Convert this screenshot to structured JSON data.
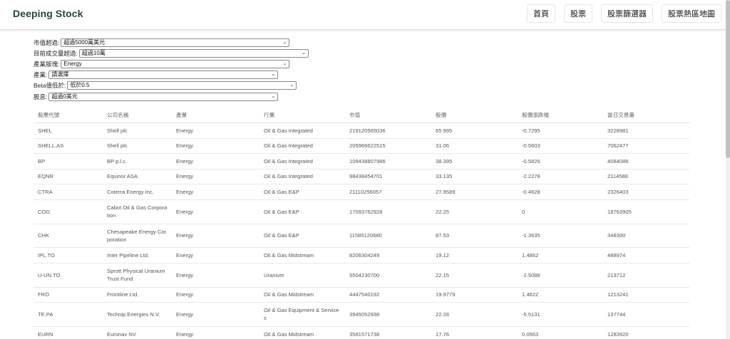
{
  "nav": {
    "brand": "Deeping Stock",
    "items": [
      "首頁",
      "股票",
      "股票篩選器",
      "股票熱區地圖"
    ]
  },
  "filters": [
    {
      "label": "市值超過:",
      "value": "超過5000萬美元"
    },
    {
      "label": "目前成交量超過:",
      "value": "超過10萬"
    },
    {
      "label": "產業版塊:",
      "value": "Energy"
    },
    {
      "label": "產業:",
      "value": "請選擇"
    },
    {
      "label": "Beta值低於:",
      "value": "低於0.5"
    },
    {
      "label": "股息:",
      "value": "超過0美元"
    }
  ],
  "table": {
    "headers": [
      "股票代號",
      "公司名稱",
      "產業",
      "行業",
      "市值",
      "股價",
      "股價漲跌幅",
      "當日交易量"
    ],
    "rows": [
      [
        "SHEL",
        "Shell plc",
        "Energy",
        "Oil & Gas Integrated",
        "219120565036",
        "65.995",
        "-0.7295",
        "3228981"
      ],
      [
        "SHELL.AS",
        "Shell plc",
        "Energy",
        "Oil & Gas Integrated",
        "205966622515",
        "31.06",
        "-0.5603",
        "7062477"
      ],
      [
        "BP",
        "BP p.l.c.",
        "Energy",
        "Oil & Gas Integrated",
        "109438807986",
        "38.395",
        "-0.5826",
        "4084086"
      ],
      [
        "EQNR",
        "Equinor ASA",
        "Energy",
        "Oil & Gas Integrated",
        "98438454701",
        "33.135",
        "-2.2278",
        "2114588"
      ],
      [
        "CTRA",
        "Coterra Energy Inc.",
        "Energy",
        "Oil & Gas E&P",
        "21110256057",
        "27.9589",
        "-0.4628",
        "2326403"
      ],
      [
        "COG",
        "Cabot Oil & Gas Corporation",
        "Energy",
        "Oil & Gas E&P",
        "17093762928",
        "22.25",
        "0",
        "18763905"
      ],
      [
        "CHK",
        "Chesapeake Energy Corporation",
        "Energy",
        "Oil & Gas E&P",
        "11585120680",
        "87.53",
        "-1.3635",
        "348390"
      ],
      [
        "IPL.TO",
        "Inter Pipeline Ltd.",
        "Energy",
        "Oil & Gas Midstream",
        "8206304249",
        "19.12",
        "1.4862",
        "488974"
      ],
      [
        "U-UN.TO",
        "Sprott Physical Uranium Trust Fund",
        "Energy",
        "Uranium",
        "5504230700",
        "22.15",
        "-2.5088",
        "213712"
      ],
      [
        "FRO",
        "Frontline Ltd.",
        "Energy",
        "Oil & Gas Midstream",
        "4447540192",
        "19.9779",
        "1.4622",
        "1213241"
      ],
      [
        "TE.PA",
        "Technip Energies N.V.",
        "Energy",
        "Oil & Gas Equipment & Services",
        "3945052938",
        "22.28",
        "-5.5131",
        "137744"
      ],
      [
        "EURN",
        "Euronav NV",
        "Energy",
        "Oil & Gas Midstream",
        "3581571738",
        "17.76",
        "0.0563",
        "1283920"
      ]
    ]
  }
}
